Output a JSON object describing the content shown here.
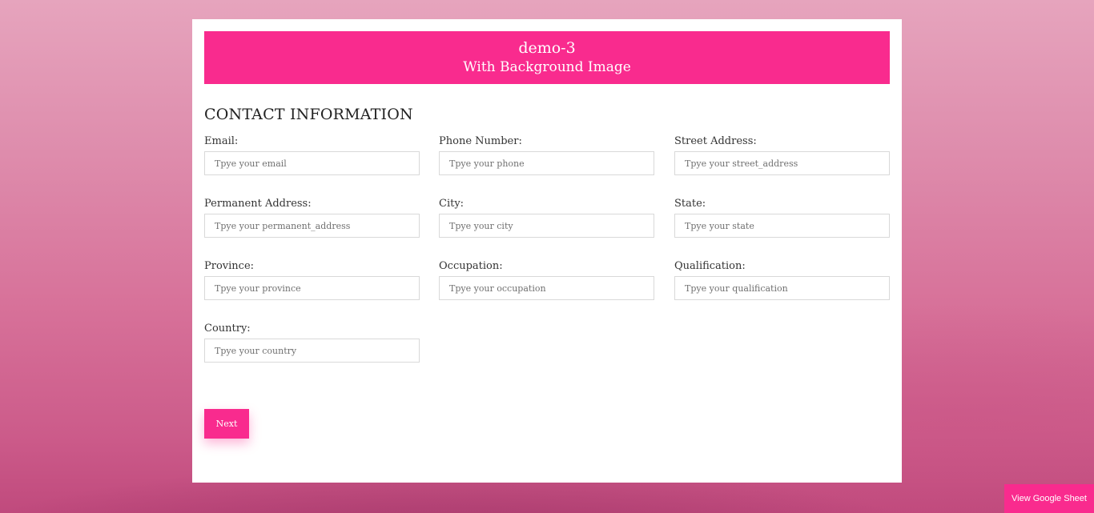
{
  "banner": {
    "line1": "demo-3",
    "line2": "With Background Image"
  },
  "section_title": "CONTACT INFORMATION",
  "fields": {
    "email": {
      "label": "Email:",
      "placeholder": "Tpye your email",
      "value": ""
    },
    "phone": {
      "label": "Phone Number:",
      "placeholder": "Tpye your phone",
      "value": ""
    },
    "street_address": {
      "label": "Street Address:",
      "placeholder": "Tpye your street_address",
      "value": ""
    },
    "permanent_address": {
      "label": "Permanent Address:",
      "placeholder": "Tpye your permanent_address",
      "value": ""
    },
    "city": {
      "label": "City:",
      "placeholder": "Tpye your city",
      "value": ""
    },
    "state": {
      "label": "State:",
      "placeholder": "Tpye your state",
      "value": ""
    },
    "province": {
      "label": "Province:",
      "placeholder": "Tpye your province",
      "value": ""
    },
    "occupation": {
      "label": "Occupation:",
      "placeholder": "Tpye your occupation",
      "value": ""
    },
    "qualification": {
      "label": "Qualification:",
      "placeholder": "Tpye your qualification",
      "value": ""
    },
    "country": {
      "label": "Country:",
      "placeholder": "Tpye your country",
      "value": ""
    }
  },
  "buttons": {
    "next": "Next",
    "view_sheet": "View Google Sheet"
  },
  "colors": {
    "accent": "#f92b8e",
    "card_background": "#ffffff",
    "background_top": "#e6a4bd",
    "background_bottom": "#c04a7d"
  }
}
